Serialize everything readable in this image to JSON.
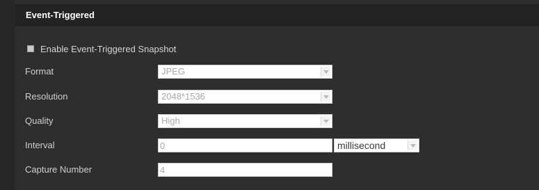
{
  "section": {
    "title": "Event-Triggered"
  },
  "enable_snapshot": {
    "label": "Enable Event-Triggered Snapshot",
    "checked": false
  },
  "format": {
    "label": "Format",
    "value": "JPEG"
  },
  "resolution": {
    "label": "Resolution",
    "value": "2048*1536"
  },
  "quality": {
    "label": "Quality",
    "value": "High"
  },
  "interval": {
    "label": "Interval",
    "value": "0",
    "unit": "millisecond"
  },
  "capture_number": {
    "label": "Capture Number",
    "value": "4"
  },
  "icons": {
    "dropdown": "chevron-down-icon"
  }
}
